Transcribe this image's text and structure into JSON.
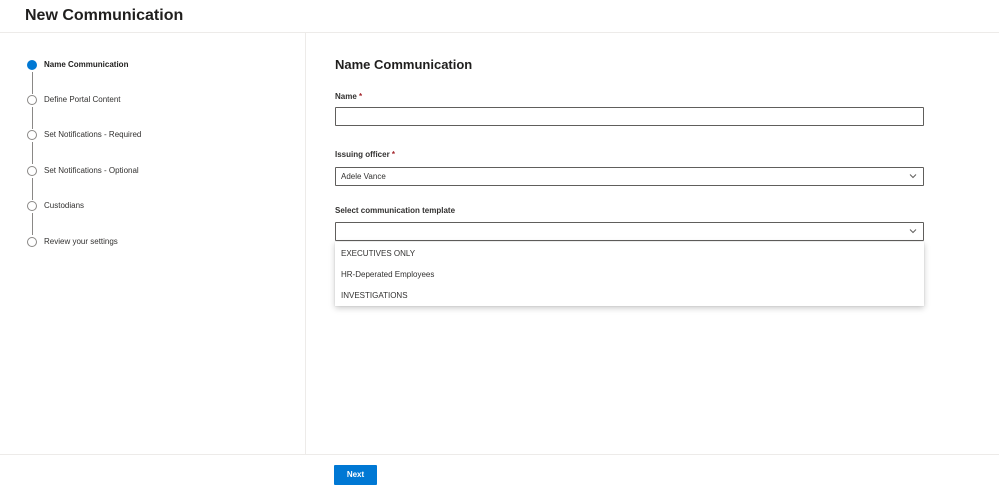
{
  "page": {
    "title": "New Communication"
  },
  "wizard": {
    "steps": [
      {
        "label": "Name Communication",
        "active": true
      },
      {
        "label": "Define Portal Content",
        "active": false
      },
      {
        "label": "Set Notifications - Required",
        "active": false
      },
      {
        "label": "Set Notifications - Optional",
        "active": false
      },
      {
        "label": "Custodians",
        "active": false
      },
      {
        "label": "Review your settings",
        "active": false
      }
    ]
  },
  "form": {
    "section_title": "Name Communication",
    "name": {
      "label": "Name",
      "required_marker": "*",
      "value": ""
    },
    "issuing_officer": {
      "label": "Issuing officer",
      "required_marker": "*",
      "value": "Adele Vance"
    },
    "template": {
      "label": "Select communication template",
      "value": "",
      "options": [
        "EXECUTIVES ONLY",
        "HR-Deperated Employees",
        "INVESTIGATIONS"
      ]
    }
  },
  "footer": {
    "next_label": "Next"
  },
  "colors": {
    "accent": "#0078d4",
    "required": "#a4262c"
  },
  "icons": {
    "dropdown": "chevron-down-icon"
  }
}
